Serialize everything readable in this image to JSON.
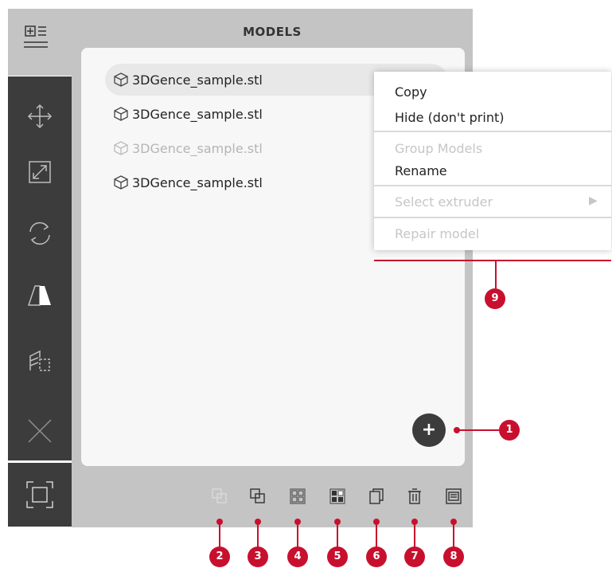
{
  "panel": {
    "title": "MODELS"
  },
  "models": [
    {
      "name": "3DGence_sample.stl",
      "selected": true,
      "disabled": false
    },
    {
      "name": "3DGence_sample.stl",
      "selected": false,
      "disabled": false
    },
    {
      "name": "3DGence_sample.stl",
      "selected": false,
      "disabled": true
    },
    {
      "name": "3DGence_sample.stl",
      "selected": false,
      "disabled": false
    }
  ],
  "context_menu": {
    "copy": "Copy",
    "hide": "Hide (don't print)",
    "group": "Group Models",
    "rename": "Rename",
    "select_extruder": "Select extruder",
    "repair": "Repair model"
  },
  "add_button": "+",
  "callouts": [
    "1",
    "2",
    "3",
    "4",
    "5",
    "6",
    "7",
    "8",
    "9"
  ],
  "colors": {
    "accent": "#c8102e",
    "toolbar": "#3c3c3c",
    "panel": "#c4c4c4"
  }
}
